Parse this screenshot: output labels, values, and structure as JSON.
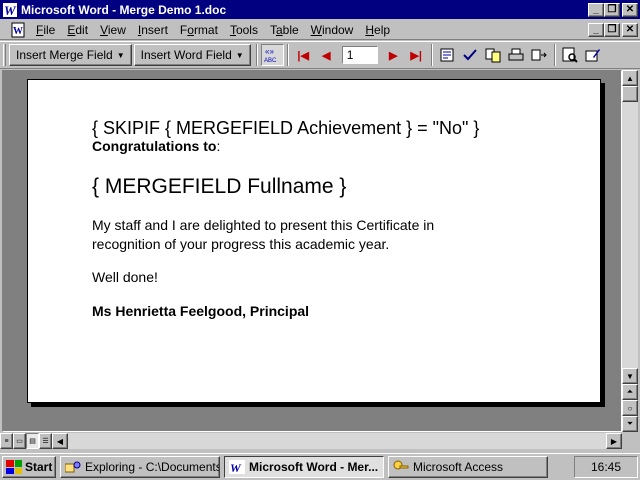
{
  "window": {
    "title": "Microsoft Word - Merge Demo 1.doc",
    "buttons": {
      "minimize": "_",
      "maximize": "❐",
      "close": "✕"
    }
  },
  "menu": {
    "items": [
      {
        "label": "File",
        "mnemonic": "F",
        "rest": "ile"
      },
      {
        "label": "Edit",
        "mnemonic": "E",
        "rest": "dit"
      },
      {
        "label": "View",
        "mnemonic": "V",
        "rest": "iew"
      },
      {
        "label": "Insert",
        "mnemonic": "I",
        "rest": "nsert"
      },
      {
        "label": "Format",
        "mnemonic": "o",
        "pre": "F",
        "rest": "rmat"
      },
      {
        "label": "Tools",
        "mnemonic": "T",
        "rest": "ools"
      },
      {
        "label": "Table",
        "mnemonic": "a",
        "pre": "T",
        "rest": "ble"
      },
      {
        "label": "Window",
        "mnemonic": "W",
        "rest": "indow"
      },
      {
        "label": "Help",
        "mnemonic": "H",
        "rest": "elp"
      }
    ]
  },
  "toolbar": {
    "insert_merge_field": "Insert Merge Field",
    "insert_word_field": "Insert Word Field",
    "view_merged_data_top": "«»",
    "view_merged_data_bottom": "ABC",
    "record_number": "1"
  },
  "document": {
    "skip_line": "{ SKIPIF { MERGEFIELD Achievement } = \"No\"  }",
    "congrats_bold": "Congratulations to",
    "congrats_colon": ":",
    "fullname_line": "{ MERGEFIELD Fullname }",
    "body_line1": "My staff and I are delighted to present this Certificate in",
    "body_line2": "recognition of your progress this academic year.",
    "well_done": "Well done!",
    "signature": "Ms Henrietta Feelgood, Principal"
  },
  "taskbar": {
    "start": "Start",
    "tasks": [
      {
        "label": "Exploring - C:\\Documents",
        "icon": "explorer-icon",
        "active": false
      },
      {
        "label": "Microsoft Word - Mer...",
        "icon": "word-icon",
        "active": true
      },
      {
        "label": "Microsoft Access",
        "icon": "access-key-icon",
        "active": false
      }
    ],
    "clock": "16:45"
  },
  "colors": {
    "titlebar": "#000080",
    "workspace": "#808080",
    "chrome": "#c0c0c0",
    "nav_arrows": "#c00000"
  }
}
